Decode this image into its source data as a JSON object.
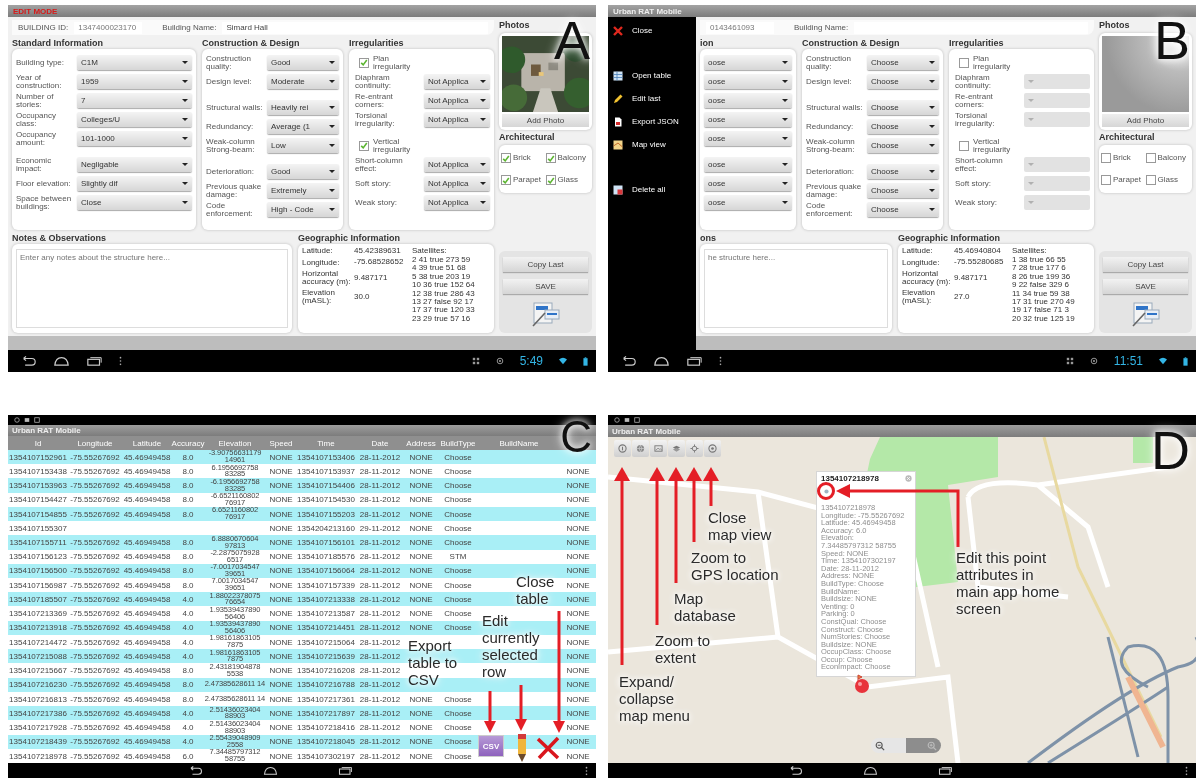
{
  "panels": [
    {
      "kind": "form",
      "label": "A",
      "title": {
        "text": "EDIT MODE",
        "alert": true
      },
      "clock": "5:49",
      "form": {
        "header": {
          "id_label": "BUILDING ID:",
          "id": "1347400023170",
          "name_label": "Building Name:",
          "name": "Simard Hall"
        },
        "sections": [
          {
            "title": "Standard Information",
            "groups": [
              [
                {
                  "label": "Building type:",
                  "value": "C1M"
                },
                {
                  "label": "Year of construction:",
                  "value": "1959"
                },
                {
                  "label": "Number of stories:",
                  "value": "7"
                },
                {
                  "label": "Occupancy class:",
                  "value": "Colleges/U"
                },
                {
                  "label": "Occupancy amount:",
                  "value": "101-1000"
                }
              ],
              [
                {
                  "label": "Economic impact:",
                  "value": "Negligable"
                },
                {
                  "label": "Floor elevation:",
                  "value": "Slightly dif"
                },
                {
                  "label": "Space between buildings:",
                  "value": "Close"
                }
              ]
            ]
          },
          {
            "title": "Construction & Design",
            "groups": [
              [
                {
                  "label": "Construction quality:",
                  "value": "Good"
                },
                {
                  "label": "Design level:",
                  "value": "Moderate"
                }
              ],
              [
                {
                  "label": "Structural walls:",
                  "value": "Heavily rei"
                },
                {
                  "label": "Redundancy:",
                  "value": "Average (1"
                },
                {
                  "label": "Weak-column Strong-beam:",
                  "value": "Low"
                }
              ],
              [
                {
                  "label": "Deterioration:",
                  "value": "Good"
                },
                {
                  "label": "Previous quake damage:",
                  "value": "Extremely"
                },
                {
                  "label": "Code enforcement:",
                  "value": "High - Code"
                }
              ]
            ]
          },
          {
            "title": "Irregularities",
            "groups": [
              [
                {
                  "kind": "checkbox",
                  "label": "Plan irregularity",
                  "checked": true
                },
                {
                  "kind": "dropdown",
                  "label": "Diaphram continuity:",
                  "value": "Not Applica",
                  "disabled": false
                },
                {
                  "kind": "dropdown",
                  "label": "Re-entrant corners:",
                  "value": "Not Applica",
                  "disabled": false
                },
                {
                  "kind": "dropdown",
                  "label": "Torsional irregularity:",
                  "value": "Not Applica",
                  "disabled": false
                }
              ],
              [
                {
                  "kind": "checkbox",
                  "label": "Vertical irregularity",
                  "checked": true
                },
                {
                  "kind": "dropdown",
                  "label": "Short-column effect:",
                  "value": "Not Applica",
                  "disabled": false
                },
                {
                  "kind": "dropdown",
                  "label": "Soft story:",
                  "value": "Not Applica",
                  "disabled": false
                },
                {
                  "kind": "dropdown",
                  "label": "Weak story:",
                  "value": "Not Applica",
                  "disabled": false
                }
              ]
            ]
          }
        ],
        "photos": {
          "title": "Photos",
          "has_photo": true,
          "button": "Add Photo"
        },
        "architectural": {
          "title": "Architectural",
          "items": [
            {
              "label": "Brick",
              "checked": true
            },
            {
              "label": "Balcony",
              "checked": true
            },
            {
              "label": "Parapet",
              "checked": true
            },
            {
              "label": "Glass",
              "checked": true
            }
          ]
        },
        "notes": {
          "title": "Notes & Observations",
          "placeholder": "Enter any notes about the structure here..."
        },
        "geo": {
          "title": "Geographic Information",
          "rows": [
            {
              "label": "Latitude:",
              "value": "45.42389631"
            },
            {
              "label": "Longitude:",
              "value": "-75.68528652"
            },
            {
              "label": "Horizontal accuracy (m):",
              "value": "9.487171"
            },
            {
              "label": "Elevation (mASL):",
              "value": "30.0"
            }
          ],
          "satellites_label": "Satellites:",
          "satellites": [
            "2 41 true 273 59",
            "4 39 true 51 68",
            "5 38 true 203 19",
            "10 36 true 152 64",
            "12 38 true 286 43",
            "13 27 false 92 17",
            "17 37 true 120 33",
            "23 29 true 57 16"
          ]
        },
        "buttons": [
          "Copy Last",
          "SAVE"
        ]
      }
    },
    {
      "kind": "form",
      "label": "B",
      "title": {
        "text": "Urban RAT Mobile",
        "alert": false
      },
      "clock": "11:51",
      "drawer": {
        "groups": [
          [
            {
              "kind": "close",
              "label": "Close"
            }
          ],
          [
            {
              "kind": "table",
              "label": "Open table"
            },
            {
              "kind": "edit",
              "label": "Edit last"
            },
            {
              "kind": "export",
              "label": "Export JSON"
            },
            {
              "kind": "map",
              "label": "Map view"
            }
          ],
          [
            {
              "kind": "delete",
              "label": "Delete all"
            }
          ]
        ]
      },
      "form": {
        "header": {
          "id": "0143461093",
          "name_label": "Building Name:"
        },
        "sections": [
          {
            "title": "ion",
            "groups": [
              [
                {
                  "value": "oose"
                },
                {
                  "value": "oose"
                },
                {
                  "value": "oose"
                },
                {
                  "value": "oose"
                },
                {
                  "value": "oose"
                }
              ],
              [
                {
                  "value": "oose"
                },
                {
                  "value": "oose"
                },
                {
                  "value": "oose"
                }
              ]
            ]
          },
          {
            "title": "Construction & Design",
            "groups": [
              [
                {
                  "label": "Construction quality:",
                  "value": "Choose"
                },
                {
                  "label": "Design level:",
                  "value": "Choose"
                }
              ],
              [
                {
                  "label": "Structural walls:",
                  "value": "Choose"
                },
                {
                  "label": "Redundancy:",
                  "value": "Choose"
                },
                {
                  "label": "Weak-column Strong-beam:",
                  "value": "Choose"
                }
              ],
              [
                {
                  "label": "Deterioration:",
                  "value": "Choose"
                },
                {
                  "label": "Previous quake damage:",
                  "value": "Choose"
                },
                {
                  "label": "Code enforcement:",
                  "value": "Choose"
                }
              ]
            ]
          },
          {
            "title": "Irregularities",
            "groups": [
              [
                {
                  "kind": "checkbox",
                  "label": "Plan irregularity",
                  "checked": false
                },
                {
                  "kind": "dropdown",
                  "label": "Diaphram continuity:",
                  "disabled": true
                },
                {
                  "kind": "dropdown",
                  "label": "Re-entrant corners:",
                  "disabled": true
                },
                {
                  "kind": "dropdown",
                  "label": "Torsional irregularity:",
                  "disabled": true
                }
              ],
              [
                {
                  "kind": "checkbox",
                  "label": "Vertical irregularity",
                  "checked": false
                },
                {
                  "kind": "dropdown",
                  "label": "Short-column effect:",
                  "disabled": true
                },
                {
                  "kind": "dropdown",
                  "label": "Soft story:",
                  "disabled": true
                },
                {
                  "kind": "dropdown",
                  "label": "Weak story:",
                  "disabled": true
                }
              ]
            ]
          }
        ],
        "photos": {
          "title": "Photos",
          "has_photo": false,
          "button": "Add Photo"
        },
        "architectural": {
          "title": "Architectural",
          "items": [
            {
              "label": "Brick",
              "checked": false
            },
            {
              "label": "Balcony",
              "checked": false
            },
            {
              "label": "Parapet",
              "checked": false
            },
            {
              "label": "Glass",
              "checked": false
            }
          ]
        },
        "notes": {
          "title": "ons",
          "placeholder": "he structure here..."
        },
        "geo": {
          "title": "Geographic Information",
          "rows": [
            {
              "label": "Latitude:",
              "value": "45.46940804"
            },
            {
              "label": "Longitude:",
              "value": "-75.55280685"
            },
            {
              "label": "Horizontal accuracy (m):",
              "value": "9.487171"
            },
            {
              "label": "Elevation (mASL):",
              "value": "27.0"
            }
          ],
          "satellites_label": "Satellites:",
          "satellites": [
            "1 38 true 66 55",
            "7 28 true 177 6",
            "8 26 true 199 36",
            "9 22 false 329 6",
            "11 34 true 59 38",
            "17 31 true 270 49",
            "19 17 false 71 3",
            "20 32 true 125 19"
          ]
        },
        "buttons": [
          "Copy Last",
          "SAVE"
        ]
      }
    },
    {
      "kind": "table",
      "label": "C",
      "title": "Urban RAT Mobile",
      "columns": [
        "Id",
        "Longitude",
        "Latitude",
        "Accuracy",
        "Elevation",
        "Speed",
        "Time",
        "Date",
        "Address",
        "BuildType",
        "BuildName"
      ],
      "rows": [
        [
          "1354107152961",
          "-75.55267692",
          "45.46949458",
          "8.0",
          "-3.90756631179 14961",
          "NONE",
          "1354107153406",
          "28-11-2012",
          "NONE",
          "Choose",
          null,
          null
        ],
        [
          "1354107153438",
          "-75.55267692",
          "45.46949458",
          "8.0",
          "6.1956692758 83285",
          "NONE",
          "1354107153937",
          "28-11-2012",
          "NONE",
          "Choose",
          null,
          "NONE"
        ],
        [
          "1354107153963",
          "-75.55267692",
          "45.46949458",
          "8.0",
          "-6.1956692758 83285",
          "NONE",
          "1354107154406",
          "28-11-2012",
          "NONE",
          "Choose",
          null,
          "NONE"
        ],
        [
          "1354107154427",
          "-75.55267692",
          "45.46949458",
          "8.0",
          "-6.6521160802 76917",
          "NONE",
          "1354107154530",
          "28-11-2012",
          "NONE",
          "Choose",
          null,
          "NONE"
        ],
        [
          "1354107154855",
          "-75.55267692",
          "45.46949458",
          "8.0",
          "6.6521160802 76917",
          "NONE",
          "1354107155203",
          "28-11-2012",
          "NONE",
          "Choose",
          null,
          "NONE"
        ],
        [
          "1354107155307",
          null,
          null,
          null,
          null,
          "NONE",
          "1354204213160",
          "29-11-2012",
          "NONE",
          "Choose",
          null,
          "NONE"
        ],
        [
          "1354107155711",
          "-75.55267692",
          "45.46949458",
          "8.0",
          "6.8880670604 97813",
          "NONE",
          "1354107156101",
          "28-11-2012",
          "NONE",
          "Choose",
          null,
          "NONE"
        ],
        [
          "1354107156123",
          "-75.55267692",
          "45.46949458",
          "8.0",
          "-2.2875075928 6517",
          "NONE",
          "1354107185576",
          "28-11-2012",
          "NONE",
          "STM",
          null,
          "NONE"
        ],
        [
          "1354107156500",
          "-75.55267692",
          "45.46949458",
          "8.0",
          "-7.0017034547 39651",
          "NONE",
          "1354107156064",
          "28-11-2012",
          "NONE",
          "Choose",
          null,
          "NONE"
        ],
        [
          "1354107156987",
          "-75.55267692",
          "45.46949458",
          "8.0",
          "7.0017034547 39651",
          "NONE",
          "1354107157339",
          "28-11-2012",
          "NONE",
          "Choose",
          null,
          "NONE"
        ],
        [
          "1354107185507",
          "-75.55267692",
          "45.46949458",
          "4.0",
          "1.88022378075 76654",
          "NONE",
          "1354107213338",
          "28-11-2012",
          "NONE",
          "Choose",
          null,
          "NONE"
        ],
        [
          "1354107213369",
          "-75.55267692",
          "45.46949458",
          "4.0",
          "1.93539437890 56406",
          "NONE",
          "1354107213587",
          "28-11-2012",
          "NONE",
          "Choose",
          null,
          "NONE"
        ],
        [
          "1354107213918",
          "-75.55267692",
          "45.46949458",
          "4.0",
          "1.93539437890 56406",
          "NONE",
          "1354107214451",
          "28-11-2012",
          "NONE",
          "Choose",
          null,
          "NONE"
        ],
        [
          "1354107214472",
          "-75.55267692",
          "45.46949458",
          "4.0",
          "1.98161863105 7875",
          "NONE",
          "1354107215064",
          "28-11-2012",
          null,
          null,
          null,
          "NONE"
        ],
        [
          "1354107215088",
          "-75.55267692",
          "45.46949458",
          "4.0",
          "1.98161863105 7875",
          "NONE",
          "1354107215639",
          "28-11-2012",
          null,
          null,
          null,
          "NONE"
        ],
        [
          "1354107215667",
          "-75.55267692",
          "45.46949458",
          "8.0",
          "2.43181904878 5538",
          "NONE",
          "1354107216208",
          "28-11-2012",
          null,
          null,
          null,
          "NONE"
        ],
        [
          "1354107216230",
          "-75.55267692",
          "45.46949458",
          "8.0",
          "2.47385628611 14",
          "NONE",
          "1354107216788",
          "28-11-2012",
          null,
          null,
          null,
          "NONE"
        ],
        [
          "1354107216813",
          "-75.55267692",
          "45.46949458",
          "8.0",
          "2.47385628611 14",
          "NONE",
          "1354107217361",
          "28-11-2012",
          "NONE",
          "Choose",
          null,
          "NONE"
        ],
        [
          "1354107217386",
          "-75.55267692",
          "45.46949458",
          "4.0",
          "2.51436023404 88903",
          "NONE",
          "1354107217897",
          "28-11-2012",
          "NONE",
          "Choose",
          null,
          "NONE"
        ],
        [
          "1354107217928",
          "-75.55267692",
          "45.46949458",
          "4.0",
          "2.51436023404 88903",
          "NONE",
          "1354107218416",
          "28-11-2012",
          "NONE",
          "Choose",
          null,
          "NONE"
        ],
        [
          "1354107218439",
          "-75.55267692",
          "45.46949458",
          "4.0",
          "2.55439048909 2558",
          "NONE",
          "1354107218045",
          "28-11-2012",
          "NONE",
          "Choose",
          null,
          "NONE"
        ],
        [
          "1354107218978",
          "-75.55267692",
          "45.46949458",
          "6.0",
          "7.34485797312 58755",
          "NONE",
          "1354107302197",
          "28-11-2012",
          "NONE",
          "Choose",
          null,
          "NONE"
        ]
      ],
      "annotations": [
        "Export\ntable to\nCSV",
        "Edit\ncurrently\nselected\nrow",
        "Close\ntable"
      ],
      "tools": [
        {
          "kind": "csv",
          "text": "CSV"
        },
        {
          "kind": "edit"
        },
        {
          "kind": "close"
        }
      ]
    },
    {
      "kind": "map",
      "label": "D",
      "title": "Urban RAT Mobile",
      "toolbar": [
        {
          "kind": "expand"
        },
        {
          "kind": "globe"
        },
        {
          "kind": "extent"
        },
        {
          "kind": "database"
        },
        {
          "kind": "gps"
        },
        {
          "kind": "close"
        }
      ],
      "popup": {
        "title": "1354107218978",
        "lines": [
          "1354107218978",
          "Longitude: -75.55267692",
          "Latitude: 45.46949458",
          "Accuracy: 6.0",
          "Elevation:",
          "7.34485797312 58755",
          "Speed: NONE",
          "Time: 1354107302197",
          "Date: 28-11-2012",
          "Address: NONE",
          "BuildType: Choose",
          "BuildName:",
          "Buildsize: NONE",
          "Venting: 0",
          "Parking: 0",
          "ConstQual: Choose",
          "Construct: Choose",
          "NumStories: Choose",
          "Buildsize: NONE",
          "OccupClass: Choose",
          "Occup: Choose",
          "EconImpact: Choose"
        ]
      },
      "annotations": [
        "Close\nmap view",
        "Zoom to\nGPS location",
        "Map\ndatabase",
        "Zoom to\nextent",
        "Expand/\ncollapse\nmap menu",
        "Edit this point\nattributes in\nmain app home\nscreen"
      ]
    }
  ]
}
